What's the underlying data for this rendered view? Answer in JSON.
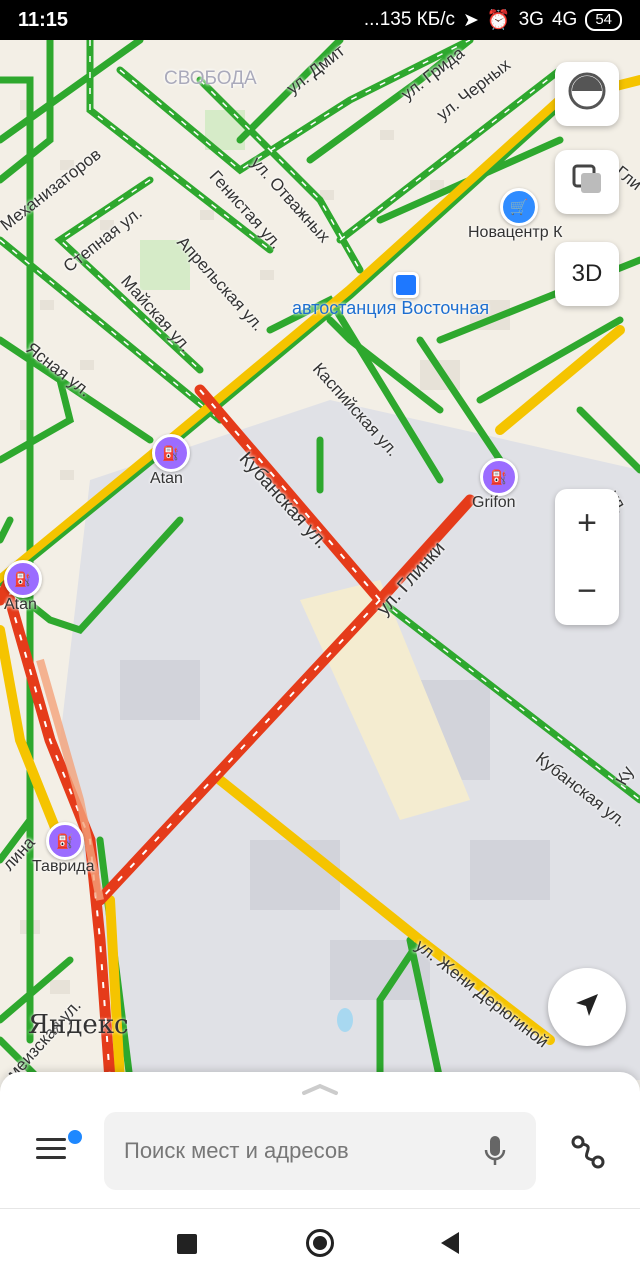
{
  "status_bar": {
    "time": "11:15",
    "speed": "...135 КБ/с",
    "net1": "3G",
    "net2": "4G",
    "battery": "54"
  },
  "map": {
    "district_label": "СВОБОДА",
    "streets": {
      "dmitr": "ул. Дмит",
      "grid": "ул. Грида",
      "chernykh": "ул. Черных",
      "glinki_top": "ул. Гли",
      "mekhanizatorov": "Механизаторов",
      "stepnaya": "Степная ул.",
      "genistaya": "Генистая ул.",
      "otvazhnykh": "ул. Отважных",
      "aprelskaya": "Апрельская ул.",
      "mayskaya": "Майская ул.",
      "yasnaya": "Ясная ул.",
      "kaspiyskaya": "Каспийская ул.",
      "kubanskaya": "Кубанская ул.",
      "glinki": "ул. Глинки",
      "kubanskaya2": "Кубанская ул.",
      "derjugina": "ул. Жени Дерюгиной",
      "ul_right": "ул.",
      "ul_kub_right": "Ку",
      "lina": "лина",
      "meizskaya": "меизская ул."
    },
    "pois": {
      "novacentr": "Новацентр К",
      "avtostanciya": "автостанция Восточная",
      "atan1": "Atan",
      "atan2": "Atan",
      "grifon": "Grifon",
      "tavrida": "Таврида"
    },
    "brand": "Яндекс",
    "btn_3d": "3D",
    "zoom_in": "+",
    "zoom_out": "−"
  },
  "search": {
    "placeholder": "Поиск мест и адресов"
  },
  "icons": {
    "layers": "traffic-layers-icon",
    "map_type": "map-type-icon",
    "locate": "location-arrow-icon",
    "menu": "hamburger-menu-icon",
    "mic": "microphone-icon",
    "route": "route-icon"
  },
  "colors": {
    "traffic_green": "#2ea82e",
    "traffic_yellow": "#f5c400",
    "traffic_red": "#e53b1a",
    "accent_blue": "#1e88ff",
    "poi_purple": "#9b6cff"
  }
}
